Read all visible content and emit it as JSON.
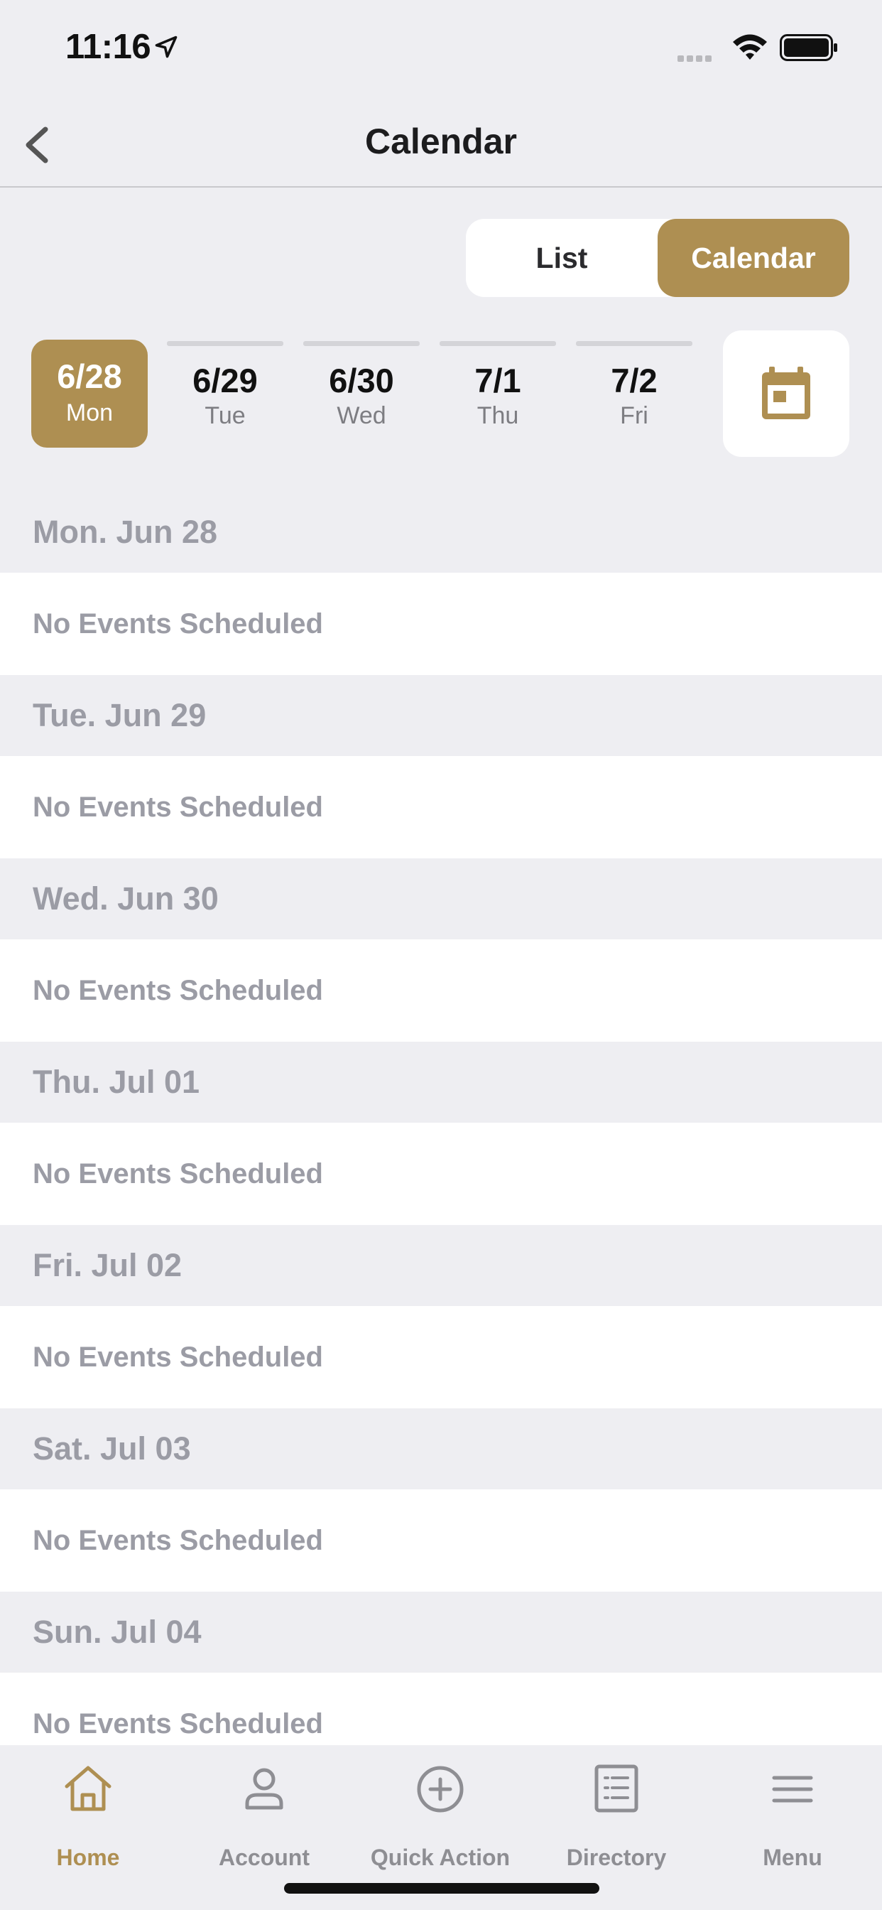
{
  "status_bar": {
    "time": "11:16"
  },
  "nav": {
    "title": "Calendar"
  },
  "toggle": {
    "list_label": "List",
    "calendar_label": "Calendar",
    "selected": "Calendar"
  },
  "date_strip": [
    {
      "date": "6/28",
      "day": "Mon",
      "selected": true
    },
    {
      "date": "6/29",
      "day": "Tue",
      "selected": false
    },
    {
      "date": "6/30",
      "day": "Wed",
      "selected": false
    },
    {
      "date": "7/1",
      "day": "Thu",
      "selected": false
    },
    {
      "date": "7/2",
      "day": "Fri",
      "selected": false
    }
  ],
  "days": [
    {
      "header": "Mon. Jun 28",
      "message": "No Events Scheduled"
    },
    {
      "header": "Tue. Jun 29",
      "message": "No Events Scheduled"
    },
    {
      "header": "Wed. Jun 30",
      "message": "No Events Scheduled"
    },
    {
      "header": "Thu. Jul 01",
      "message": "No Events Scheduled"
    },
    {
      "header": "Fri. Jul 02",
      "message": "No Events Scheduled"
    },
    {
      "header": "Sat. Jul 03",
      "message": "No Events Scheduled"
    },
    {
      "header": "Sun. Jul 04",
      "message": "No Events Scheduled"
    }
  ],
  "tabs": [
    {
      "label": "Home",
      "icon": "home-icon",
      "active": true
    },
    {
      "label": "Account",
      "icon": "user-icon",
      "active": false
    },
    {
      "label": "Quick Action",
      "icon": "plus-circle-icon",
      "active": false
    },
    {
      "label": "Directory",
      "icon": "list-document-icon",
      "active": false
    },
    {
      "label": "Menu",
      "icon": "hamburger-menu-icon",
      "active": false
    }
  ],
  "colors": {
    "accent": "#ae8f52",
    "muted_text": "#9b9ca5",
    "background": "#eeeef2"
  }
}
